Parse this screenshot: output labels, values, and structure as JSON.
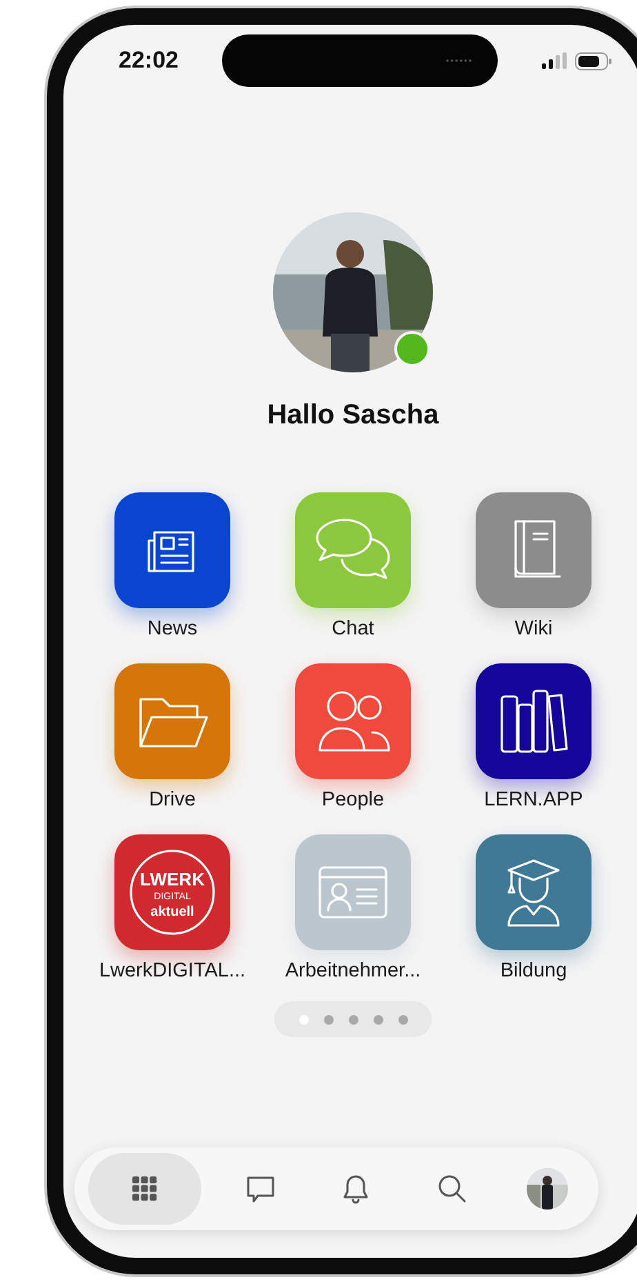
{
  "status_bar": {
    "time": "22:02"
  },
  "profile": {
    "greeting": "Hallo Sascha",
    "online": true
  },
  "apps": [
    {
      "label": "News",
      "kind": "news",
      "color": "#0a45d0"
    },
    {
      "label": "Chat",
      "kind": "chat",
      "color": "#8cc83e"
    },
    {
      "label": "Wiki",
      "kind": "book",
      "color": "#8c8c8c"
    },
    {
      "label": "Drive",
      "kind": "folder",
      "color": "#d5750a"
    },
    {
      "label": "People",
      "kind": "people",
      "color": "#f04a3c"
    },
    {
      "label": "LERN.APP",
      "kind": "books",
      "color": "#14069a"
    },
    {
      "label": "LwerkDIGITAL...",
      "kind": "logo",
      "color": "#d02a2e",
      "logo_lines": [
        "LWERK",
        "DIGITAL",
        "aktuell"
      ]
    },
    {
      "label": "Arbeitnehmer...",
      "kind": "idcard",
      "color": "#bcc6ce"
    },
    {
      "label": "Bildung",
      "kind": "graduate",
      "color": "#3f7995"
    }
  ],
  "pages": [
    {
      "selected": true
    },
    {
      "selected": false
    },
    {
      "selected": false
    },
    {
      "selected": false
    },
    {
      "selected": false
    }
  ],
  "tab_bar": [
    {
      "kind": "grid",
      "selected": true
    },
    {
      "kind": "chat",
      "selected": false
    },
    {
      "kind": "bell",
      "selected": false
    },
    {
      "kind": "search",
      "selected": false
    },
    {
      "kind": "avatar",
      "selected": false
    }
  ]
}
